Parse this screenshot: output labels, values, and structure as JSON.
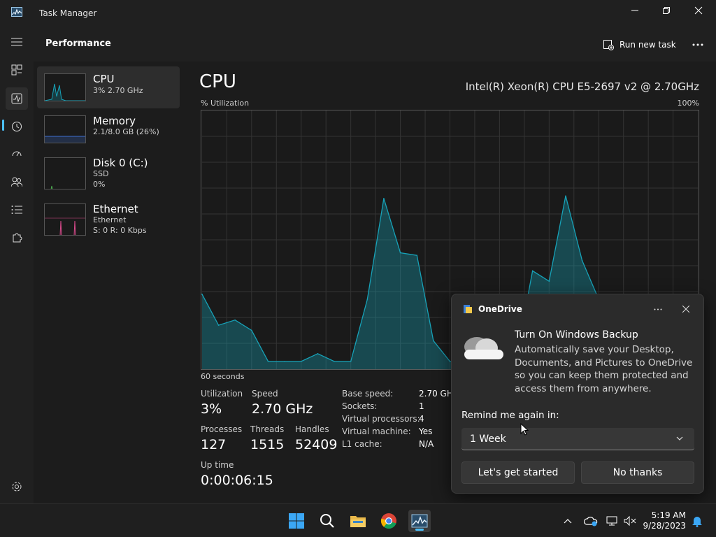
{
  "window": {
    "title": "Task Manager"
  },
  "header": {
    "page_title": "Performance",
    "run_new_task_label": "Run new task"
  },
  "colors": {
    "accent": "#4cc2ff",
    "cpu_line": "#17a2b8",
    "memory_line": "#3f6fd1",
    "disk_line": "#4caf50",
    "ethernet_line": "#d94a8c"
  },
  "sidebar": {
    "items": [
      {
        "name": "CPU",
        "sub1": "3% 2.70 GHz",
        "sub2": ""
      },
      {
        "name": "Memory",
        "sub1": "2.1/8.0 GB (26%)",
        "sub2": ""
      },
      {
        "name": "Disk 0 (C:)",
        "sub1": "SSD",
        "sub2": "0%"
      },
      {
        "name": "Ethernet",
        "sub1": "Ethernet",
        "sub2": "S: 0 R: 0 Kbps"
      }
    ]
  },
  "cpu": {
    "title": "CPU",
    "model": "Intel(R) Xeon(R) CPU E5-2697 v2 @ 2.70GHz",
    "graph_label": "% Utilization",
    "graph_max": "100%",
    "time_span": "60 seconds",
    "utilization_label": "Utilization",
    "utilization": "3%",
    "speed_label": "Speed",
    "speed": "2.70 GHz",
    "processes_label": "Processes",
    "processes": "127",
    "threads_label": "Threads",
    "threads": "1515",
    "handles_label": "Handles",
    "handles": "52409",
    "uptime_label": "Up time",
    "uptime": "0:00:06:15",
    "details": [
      {
        "key": "Base speed:",
        "value": "2.70 GHz"
      },
      {
        "key": "Sockets:",
        "value": "1"
      },
      {
        "key": "Virtual processors:",
        "value": "4"
      },
      {
        "key": "Virtual machine:",
        "value": "Yes"
      },
      {
        "key": "L1 cache:",
        "value": "N/A"
      }
    ]
  },
  "chart_data": {
    "type": "area",
    "x": [
      60,
      58,
      56,
      54,
      52,
      50,
      48,
      46,
      44,
      42,
      40,
      38,
      36,
      34,
      32,
      30,
      28,
      26,
      24,
      22,
      20,
      18,
      16,
      14,
      12,
      10,
      8,
      6,
      4,
      2,
      0
    ],
    "values": [
      29,
      17,
      19,
      15,
      3,
      3,
      3,
      6,
      3,
      3,
      27,
      66,
      45,
      44,
      11,
      3,
      3,
      14,
      4,
      4,
      38,
      34,
      67,
      42,
      27,
      4,
      3,
      3,
      2,
      2,
      3
    ],
    "ylim": [
      0,
      100
    ],
    "grid": true
  },
  "notification": {
    "app": "OneDrive",
    "heading": "Turn On Windows Backup",
    "body": "Automatically save your Desktop, Documents, and Pictures to OneDrive so you can keep them protected and access them from anywhere.",
    "remind_label": "Remind me again in:",
    "remind_value": "1 Week",
    "primary_button": "Let's get started",
    "secondary_button": "No thanks"
  },
  "taskbar": {
    "icons": [
      "start-icon",
      "search-icon",
      "file-explorer-icon",
      "chrome-icon",
      "task-manager-icon"
    ],
    "time": "5:19 AM",
    "date": "9/28/2023"
  }
}
